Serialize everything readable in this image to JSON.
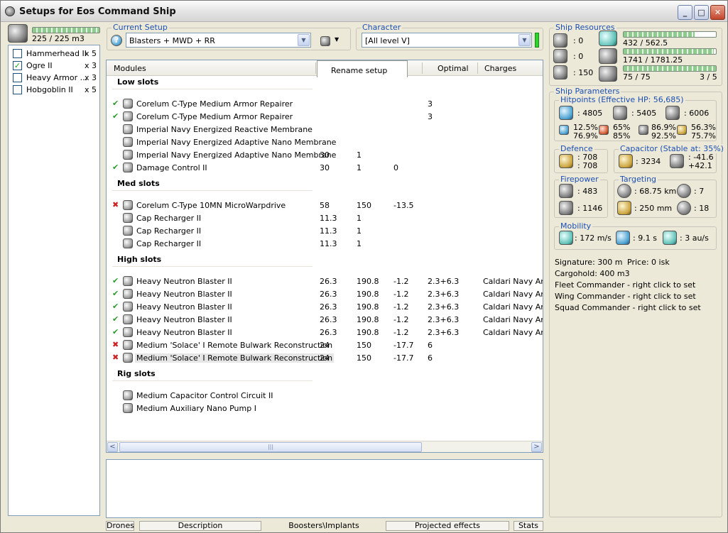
{
  "window": {
    "title": "Setups for Eos Command Ship"
  },
  "drone_bay": {
    "usage": "225 / 225 m3",
    "fill": 1.0,
    "drones": [
      {
        "name": "Hammerhead II",
        "qty": "x 5",
        "checked": false
      },
      {
        "name": "Ogre II",
        "qty": "x 3",
        "checked": true
      },
      {
        "name": "Heavy Armor ...",
        "qty": "x 3",
        "checked": false
      },
      {
        "name": "Hobgoblin II",
        "qty": "x 5",
        "checked": false
      }
    ]
  },
  "current_setup": {
    "label": "Current Setup",
    "value": "Blasters + MWD  + RR"
  },
  "character": {
    "label": "Character",
    "value": "[All level V]"
  },
  "modules": {
    "headers": [
      "Modules",
      "Rename setup",
      "Optimal",
      "Charges"
    ],
    "sections": [
      {
        "title": "Low slots",
        "rows": [
          {
            "status": "ok",
            "name": "Corelum C-Type Medium Armor Repairer",
            "c1": "",
            "c2": "",
            "c3": "",
            "c4": "3",
            "c5": ""
          },
          {
            "status": "ok",
            "name": "Corelum C-Type Medium Armor Repairer",
            "c1": "",
            "c2": "",
            "c3": "",
            "c4": "3",
            "c5": ""
          },
          {
            "status": "",
            "name": "Imperial Navy Energized Reactive Membrane",
            "c1": "",
            "c2": "",
            "c3": "",
            "c4": "",
            "c5": ""
          },
          {
            "status": "",
            "name": "Imperial Navy Energized Adaptive Nano Membrane",
            "c1": "",
            "c2": "",
            "c3": "",
            "c4": "",
            "c5": ""
          },
          {
            "status": "",
            "name": "Imperial Navy Energized Adaptive Nano Membrane",
            "c1": "30",
            "c2": "1",
            "c3": "",
            "c4": "",
            "c5": ""
          },
          {
            "status": "ok",
            "name": "Damage Control II",
            "c1": "30",
            "c2": "1",
            "c3": "0",
            "c4": "",
            "c5": ""
          }
        ]
      },
      {
        "title": "Med slots",
        "rows": [
          {
            "status": "bad",
            "name": "Corelum C-Type 10MN MicroWarpdrive",
            "c1": "58",
            "c2": "150",
            "c3": "-13.5",
            "c4": "",
            "c5": ""
          },
          {
            "status": "",
            "name": "Cap Recharger II",
            "c1": "11.3",
            "c2": "1",
            "c3": "",
            "c4": "",
            "c5": ""
          },
          {
            "status": "",
            "name": "Cap Recharger II",
            "c1": "11.3",
            "c2": "1",
            "c3": "",
            "c4": "",
            "c5": ""
          },
          {
            "status": "",
            "name": "Cap Recharger II",
            "c1": "11.3",
            "c2": "1",
            "c3": "",
            "c4": "",
            "c5": ""
          }
        ]
      },
      {
        "title": "High slots",
        "rows": [
          {
            "status": "ok",
            "name": "Heavy Neutron Blaster II",
            "c1": "26.3",
            "c2": "190.8",
            "c3": "-1.2",
            "c4": "2.3+6.3",
            "c5": "Caldari Navy Antimatter"
          },
          {
            "status": "ok",
            "name": "Heavy Neutron Blaster II",
            "c1": "26.3",
            "c2": "190.8",
            "c3": "-1.2",
            "c4": "2.3+6.3",
            "c5": "Caldari Navy Antimatter"
          },
          {
            "status": "ok",
            "name": "Heavy Neutron Blaster II",
            "c1": "26.3",
            "c2": "190.8",
            "c3": "-1.2",
            "c4": "2.3+6.3",
            "c5": "Caldari Navy Antimatter"
          },
          {
            "status": "ok",
            "name": "Heavy Neutron Blaster II",
            "c1": "26.3",
            "c2": "190.8",
            "c3": "-1.2",
            "c4": "2.3+6.3",
            "c5": "Caldari Navy Antimatter"
          },
          {
            "status": "ok",
            "name": "Heavy Neutron Blaster II",
            "c1": "26.3",
            "c2": "190.8",
            "c3": "-1.2",
            "c4": "2.3+6.3",
            "c5": "Caldari Navy Antimatter"
          },
          {
            "status": "bad",
            "name": "Medium 'Solace' I Remote Bulwark Reconstruction",
            "c1": "24",
            "c2": "150",
            "c3": "-17.7",
            "c4": "6",
            "c5": ""
          },
          {
            "status": "bad",
            "name": "Medium 'Solace' I Remote Bulwark Reconstruction",
            "c1": "24",
            "c2": "150",
            "c3": "-17.7",
            "c4": "6",
            "c5": "",
            "selected": true
          }
        ]
      },
      {
        "title": "Rig slots",
        "rows": [
          {
            "status": "",
            "name": "Medium Capacitor Control Circuit II",
            "c1": "",
            "c2": "",
            "c3": "",
            "c4": "",
            "c5": ""
          },
          {
            "status": "",
            "name": "Medium Auxiliary Nano Pump I",
            "c1": "",
            "c2": "",
            "c3": "",
            "c4": "",
            "c5": ""
          }
        ]
      }
    ]
  },
  "scroll": {
    "arrow_left": "<",
    "arrow_right": ">",
    "grip": "|||"
  },
  "bottom_tabs": [
    "Drones",
    "Description",
    "Boosters\\Implants",
    "Projected effects",
    "Stats"
  ],
  "ship_resources": {
    "label": "Ship Resources",
    "hardpoints": [
      {
        "icon": "turret-hardpoint-icon",
        "value": ": 0"
      },
      {
        "icon": "launcher-hardpoint-icon",
        "value": ": 0"
      },
      {
        "icon": "drone-bandwidth-icon",
        "value": ": 150"
      }
    ],
    "cpu": {
      "text": "432 / 562.5",
      "fill": 0.768
    },
    "powergrid": {
      "text": "1741 / 1781.25",
      "fill": 0.977
    },
    "calibration": {
      "text": "75 / 75",
      "fill": 1.0
    },
    "rigs": "3 / 5"
  },
  "ship_parameters": {
    "label": "Ship Parameters",
    "hitpoints": {
      "label": "Hitpoints (Effective HP: 56,685)",
      "shield": ": 4805",
      "armor": ": 5405",
      "structure": ": 6006",
      "resists": [
        {
          "icon": "em-resist-icon",
          "top": "12.5%",
          "bottom": "76.9%"
        },
        {
          "icon": "thermal-resist-icon",
          "top": "65%",
          "bottom": "85%"
        },
        {
          "icon": "kinetic-resist-icon",
          "top": "86.9%",
          "bottom": "92.5%"
        },
        {
          "icon": "explosive-resist-icon",
          "top": "56.3%",
          "bottom": "75.7%"
        }
      ]
    },
    "defence": {
      "label": "Defence",
      "top": ": 708",
      "bottom": ": 708"
    },
    "capacitor": {
      "label": "Capacitor (Stable at: 35%)",
      "amount": ": 3234",
      "top": ": -41.6",
      "bottom": "+42.1"
    },
    "firepower": {
      "label": "Firepower",
      "dps": ": 483",
      "volley": ": 1146"
    },
    "targeting": {
      "label": "Targeting",
      "range": ": 68.75 km",
      "targets": ": 7",
      "resolution": ": 250 mm",
      "sensor": ": 18"
    },
    "mobility": {
      "label": "Mobility",
      "speed": ": 172 m/s",
      "align": ": 9.1 s",
      "warp": ": 3 au/s"
    }
  },
  "info": {
    "signature": "Signature: 300 m",
    "price": "Price: 0 isk",
    "cargohold": "Cargohold: 400 m3",
    "fleet": "Fleet Commander - right click to set",
    "wing": "Wing Commander - right click to set",
    "squad": "Squad Commander - right click to set"
  }
}
